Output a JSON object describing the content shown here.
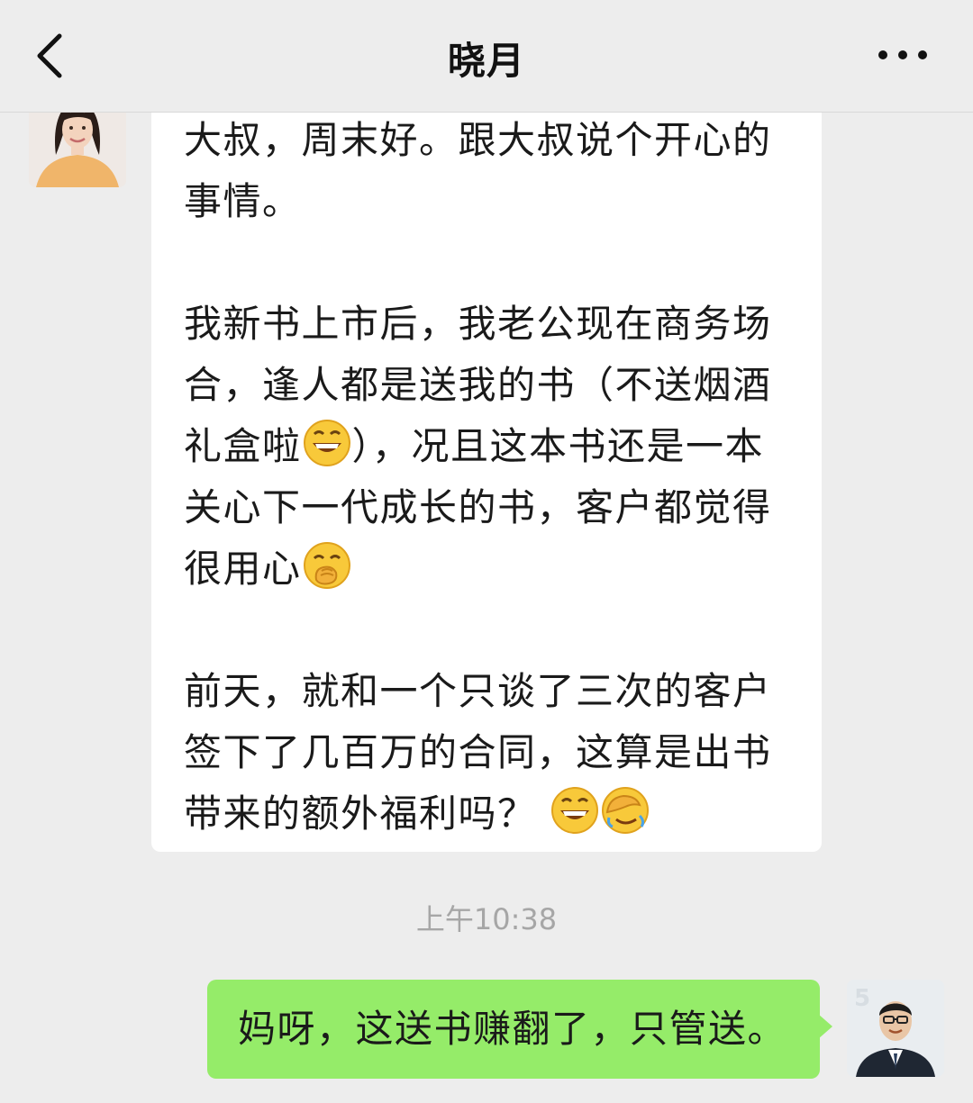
{
  "header": {
    "title": "晓月"
  },
  "messages": {
    "incoming": {
      "paragraphs": [
        "大叔，周末好。跟大叔说个开心的事情。",
        "我新书上市后，我老公现在商务场合，逢人都是送我的书（不送烟酒礼盒啦",
        "），况且这本书还是一本关心下一代成长的书，客户都觉得很用心",
        "前天，就和一个只谈了三次的客户签下了几百万的合同，这算是出书带来的额外福利吗？"
      ]
    },
    "timestamp": "上午10:38",
    "outgoing": {
      "text": "妈呀，这送书赚翻了，只管送。"
    }
  },
  "avatar_right": {
    "badge": "5"
  },
  "icons": {
    "back": "chevron-left-icon",
    "more": "more-dots-icon",
    "emoji_grin": "grin-emoji-icon",
    "emoji_smirk": "hand-over-mouth-emoji-icon",
    "emoji_facepalm": "facepalm-emoji-icon"
  },
  "colors": {
    "nav_bg": "#ededed",
    "chat_bg": "#ededed",
    "incoming_bubble": "#ffffff",
    "outgoing_bubble": "#95ec69",
    "timestamp": "#a6a6a6"
  }
}
